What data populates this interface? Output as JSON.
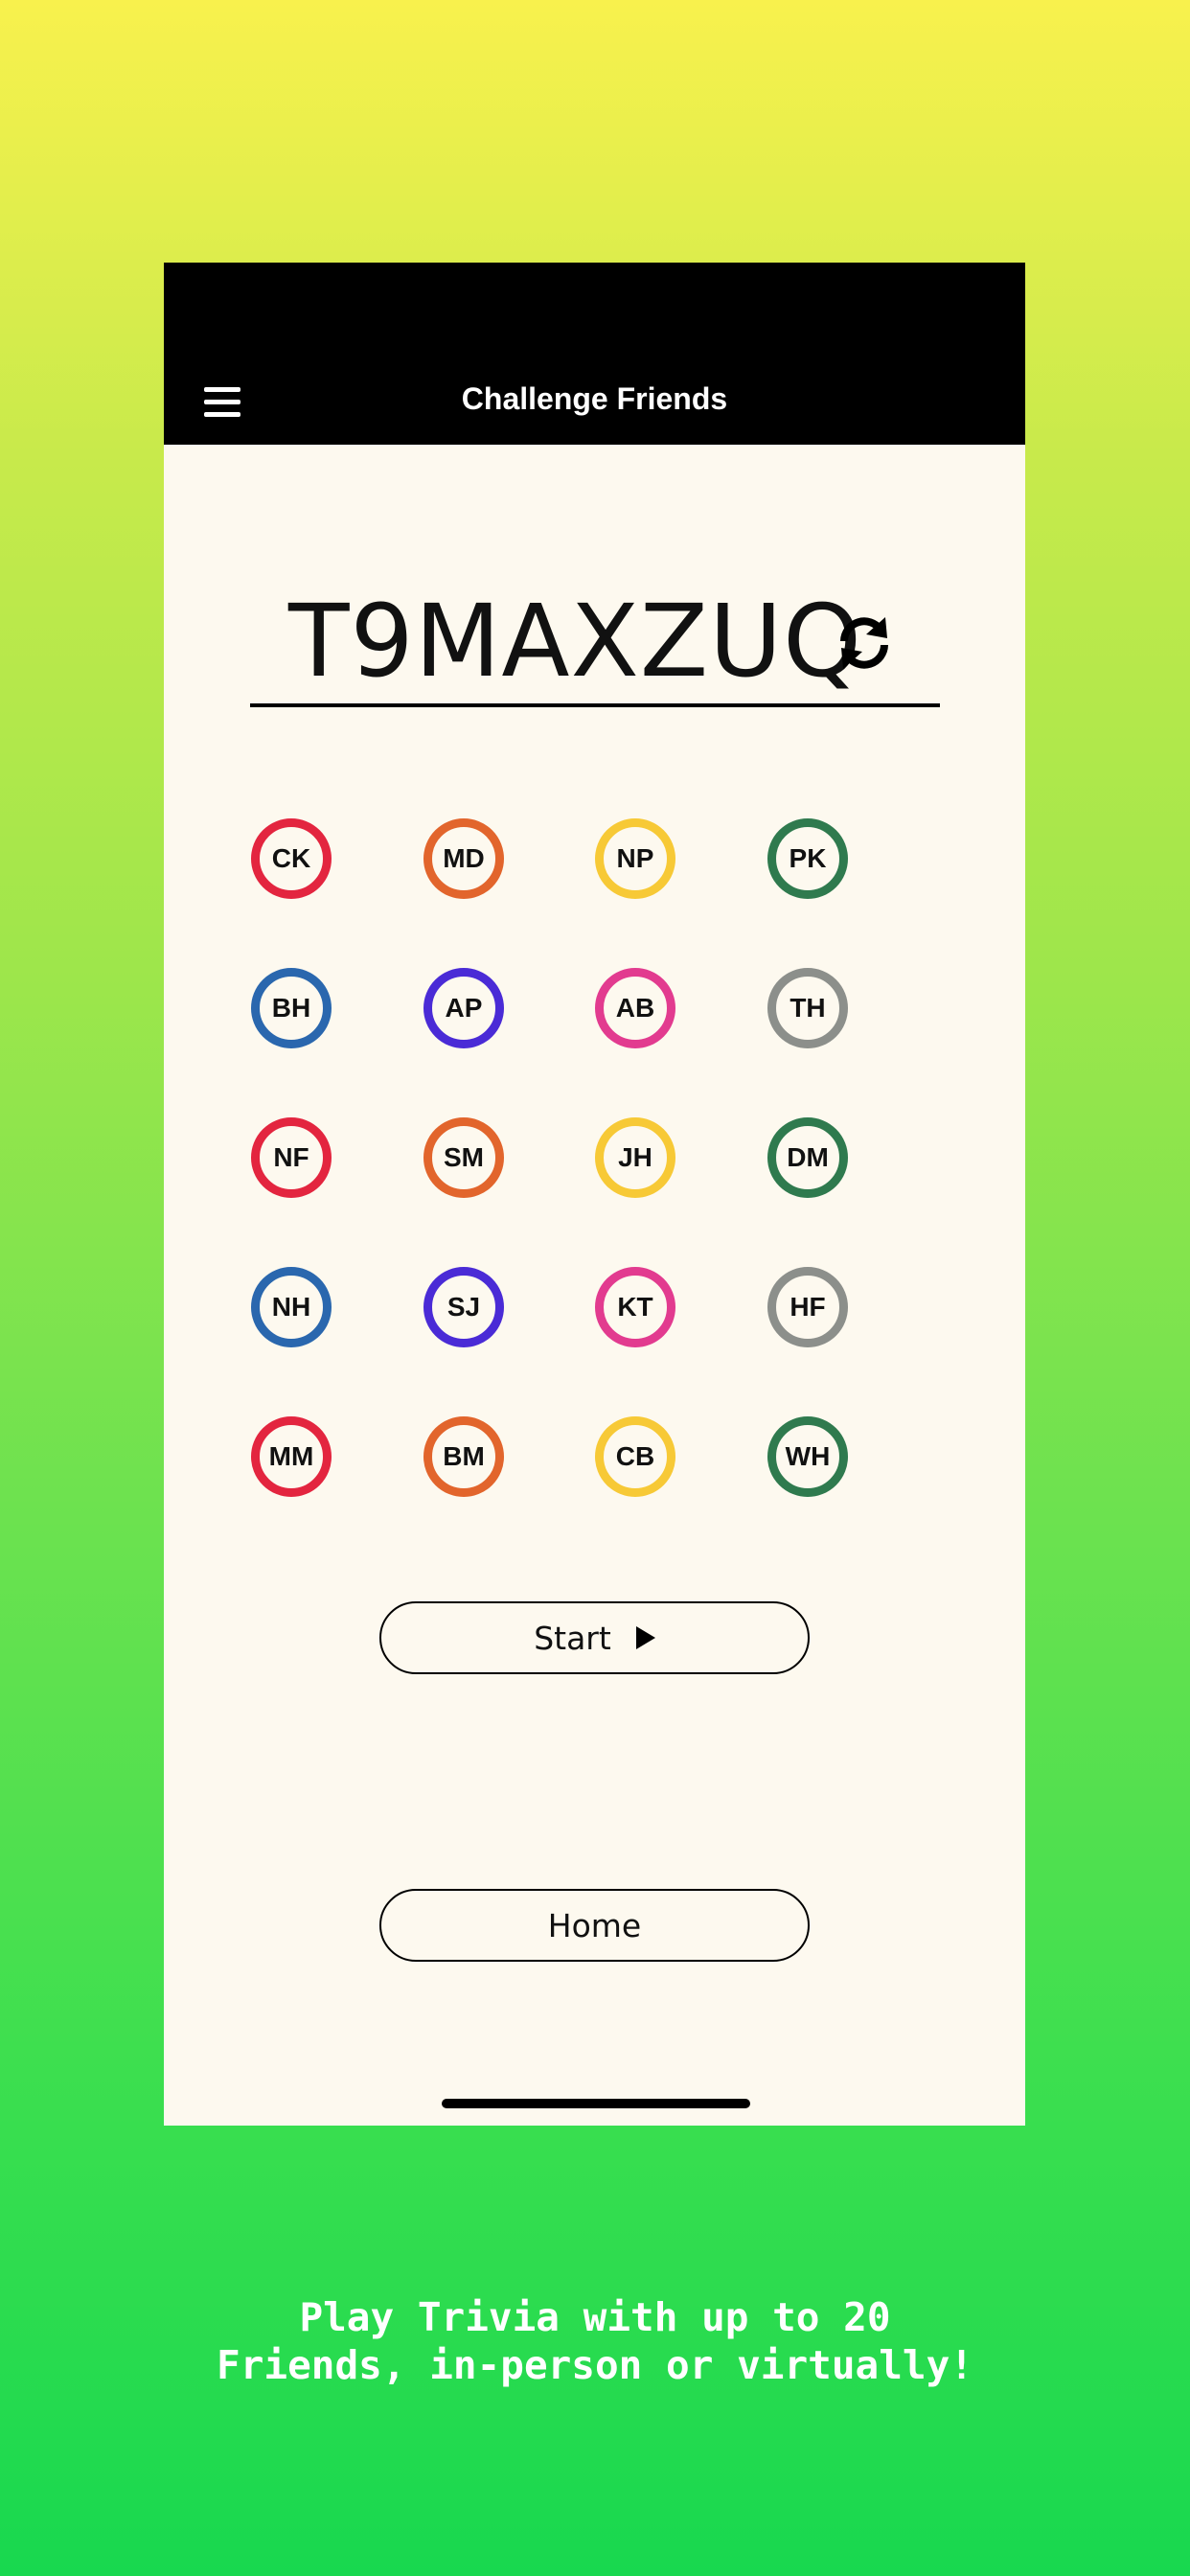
{
  "header": {
    "title": "Challenge Friends",
    "menu_icon": "hamburger-menu-icon"
  },
  "code": {
    "value": "T9MAXZUQ",
    "refresh_icon": "refresh-icon"
  },
  "players": [
    {
      "initials": "CK",
      "color": "#e3253f"
    },
    {
      "initials": "MD",
      "color": "#e2652c"
    },
    {
      "initials": "NP",
      "color": "#f7c936"
    },
    {
      "initials": "PK",
      "color": "#2f7a4e"
    },
    {
      "initials": "BH",
      "color": "#2a67ae"
    },
    {
      "initials": "AP",
      "color": "#4a2bd6"
    },
    {
      "initials": "AB",
      "color": "#e23b8f"
    },
    {
      "initials": "TH",
      "color": "#8c8f8b"
    },
    {
      "initials": "NF",
      "color": "#e3253f"
    },
    {
      "initials": "SM",
      "color": "#e2652c"
    },
    {
      "initials": "JH",
      "color": "#f7c936"
    },
    {
      "initials": "DM",
      "color": "#2f7a4e"
    },
    {
      "initials": "NH",
      "color": "#2a67ae"
    },
    {
      "initials": "SJ",
      "color": "#4a2bd6"
    },
    {
      "initials": "KT",
      "color": "#e23b8f"
    },
    {
      "initials": "HF",
      "color": "#8c8f8b"
    },
    {
      "initials": "MM",
      "color": "#e3253f"
    },
    {
      "initials": "BM",
      "color": "#e2652c"
    },
    {
      "initials": "CB",
      "color": "#f7c936"
    },
    {
      "initials": "WH",
      "color": "#2f7a4e"
    }
  ],
  "buttons": {
    "start_label": "Start",
    "start_icon": "play-icon",
    "home_label": "Home"
  },
  "caption": {
    "line1": "Play Trivia with up to 20",
    "line2": "Friends, in-person or virtually!"
  }
}
